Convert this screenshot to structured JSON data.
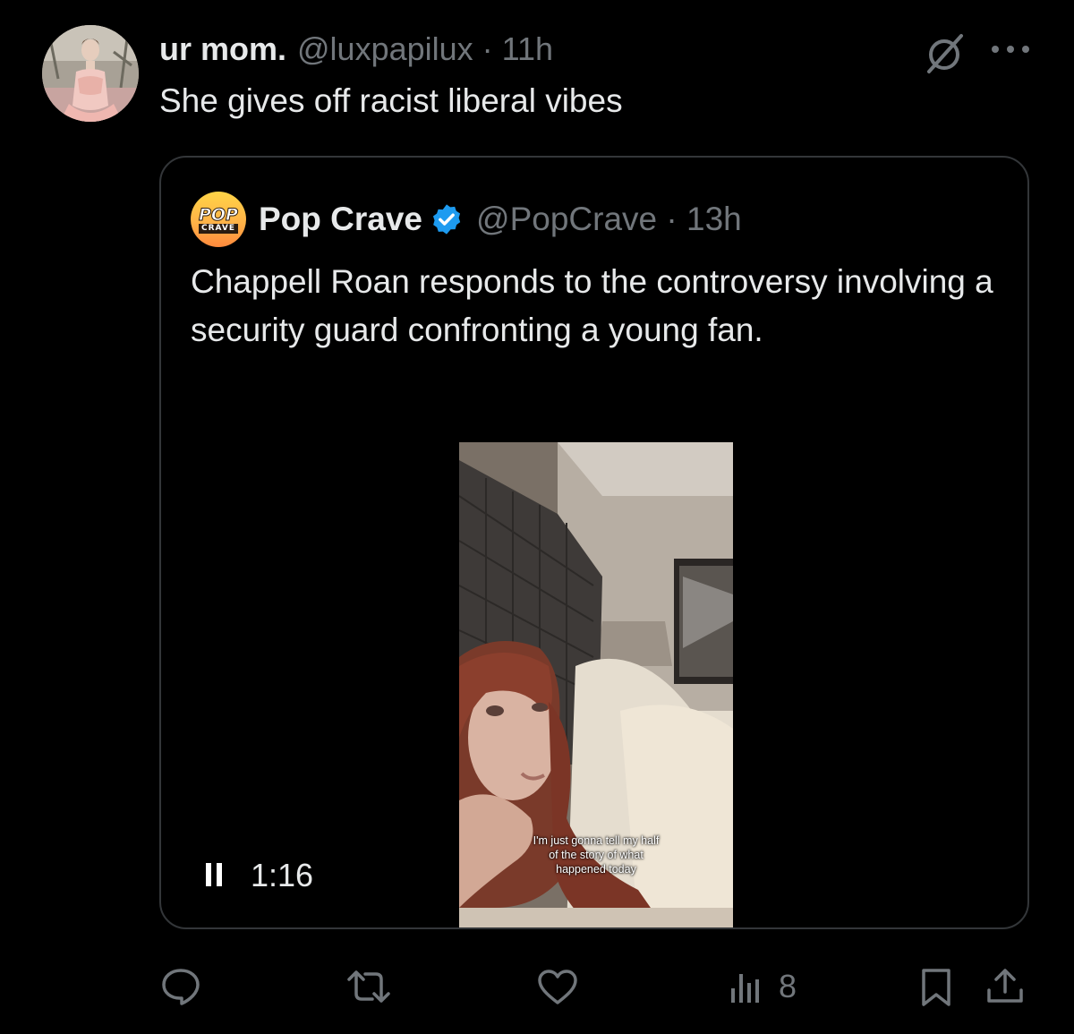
{
  "post": {
    "display_name": "ur mom.",
    "handle_time": "@luxpapilux · 11h",
    "text": "She gives off racist liberal vibes"
  },
  "quote": {
    "display_name": "Pop Crave",
    "avatar_top": "POP",
    "avatar_bottom": "CRAVE",
    "handle_time": "@PopCrave · 13h",
    "text": "Chappell Roan responds to the controversy involving a security guard confronting a young fan.",
    "video": {
      "caption_line1": "I'm just gonna tell my half",
      "caption_line2": "of the story of what",
      "caption_line3": "happened today",
      "duration": "1:16"
    }
  },
  "actions": {
    "views": "8"
  },
  "icons": {
    "reply": "reply-icon",
    "repost": "repost-icon",
    "like": "like-icon",
    "views": "views-icon",
    "bookmark": "bookmark-icon",
    "share": "share-icon",
    "grok": "grok-icon",
    "more": "more-icon",
    "verified": "verified-badge-icon",
    "pause": "pause-icon"
  },
  "colors": {
    "background": "#000000",
    "text_primary": "#e7e9ea",
    "text_secondary": "#71767b",
    "border": "#333639",
    "verified": "#1d9bf0"
  }
}
